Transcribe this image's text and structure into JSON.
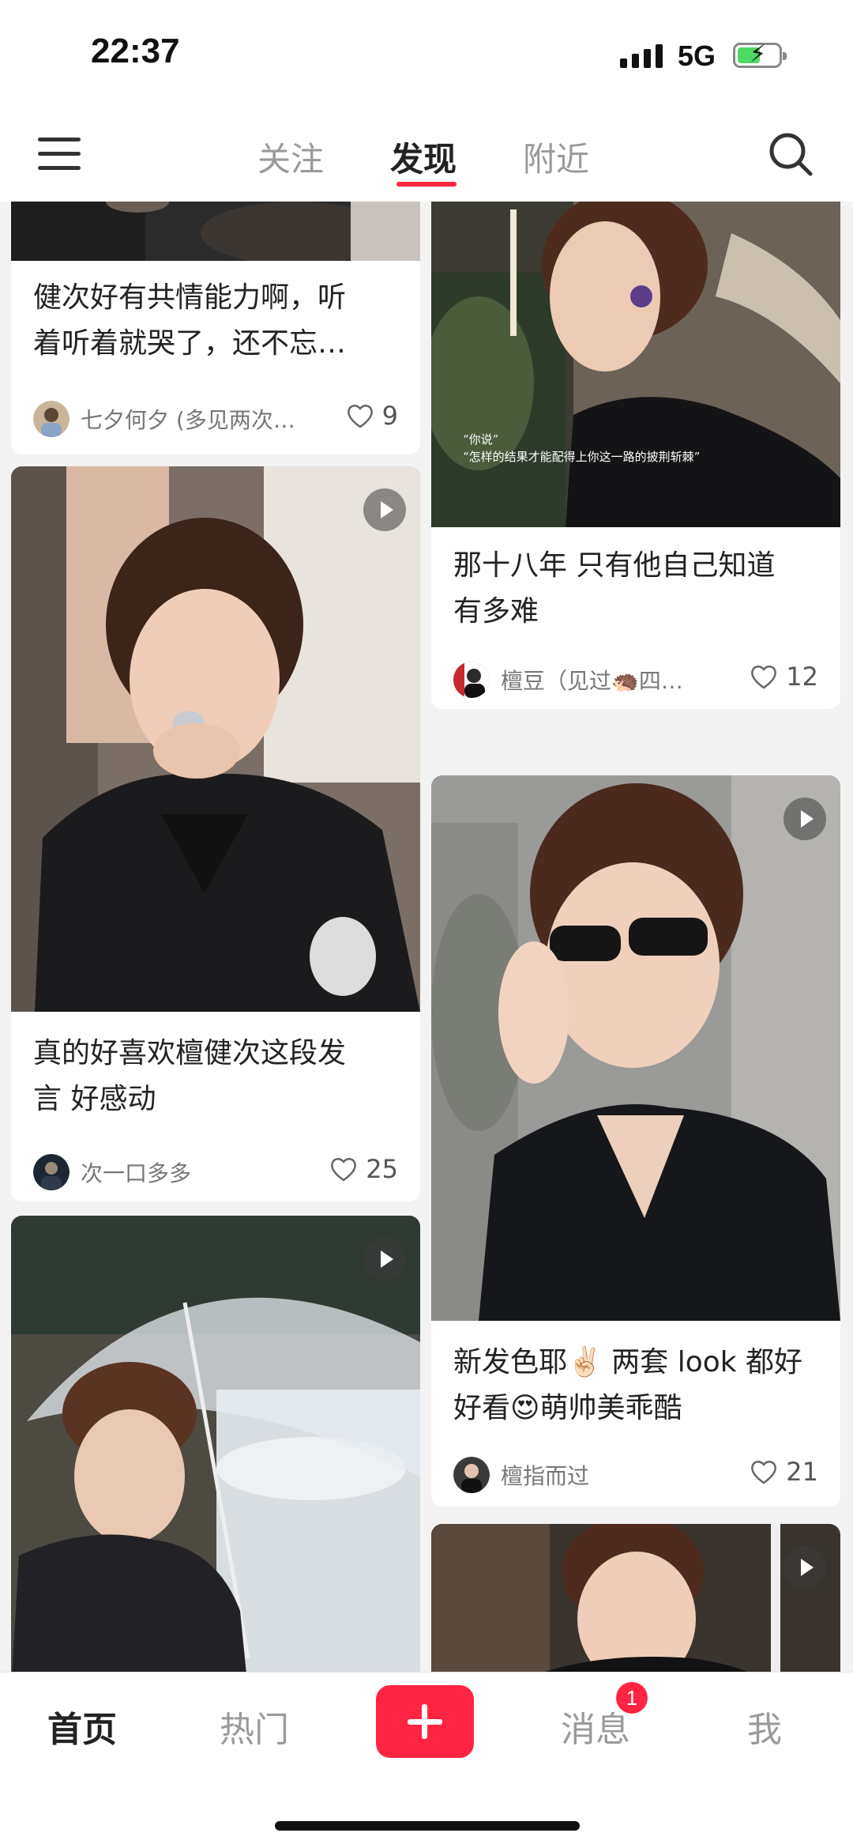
{
  "status_bar": {
    "time": "22:37",
    "network": "5G"
  },
  "top_nav": {
    "tabs": [
      {
        "label": "关注"
      },
      {
        "label": "发现",
        "active": true
      },
      {
        "label": "附近"
      }
    ],
    "icons": [
      "menu-icon",
      "search-icon"
    ],
    "accent_color": "#ff2442"
  },
  "feed": {
    "cards": [
      {
        "title_lines": [
          "健次好有共情能力啊，听",
          "着听着就哭了，还不忘…"
        ],
        "author": "七夕何夕 (多见两次…",
        "likes": "9"
      },
      {
        "photo_caption": [
          "“你说”",
          "“怎样的结果才能配得上你这一路的披荆斩棘”"
        ],
        "title_lines": [
          "那十八年 只有他自己知道",
          "有多难"
        ],
        "author": "檀豆（见过🦔四…",
        "likes": "12"
      },
      {
        "title_lines": [
          "真的好喜欢檀健次这段发",
          "言 好感动"
        ],
        "author": "次一口多多",
        "likes": "25",
        "is_video": true
      },
      {
        "title_lines": [
          "新发色耶✌🏻 两套 look 都好",
          "好看😍萌帅美乖酷"
        ],
        "author": "檀指而过",
        "likes": "21",
        "is_video": true
      },
      {
        "is_video": true
      },
      {
        "is_video": true
      }
    ]
  },
  "bottom_nav": {
    "items": [
      {
        "label": "首页",
        "active": true
      },
      {
        "label": "热门"
      },
      {
        "label": "消息"
      },
      {
        "label": "我"
      }
    ],
    "messages_badge": "1"
  }
}
